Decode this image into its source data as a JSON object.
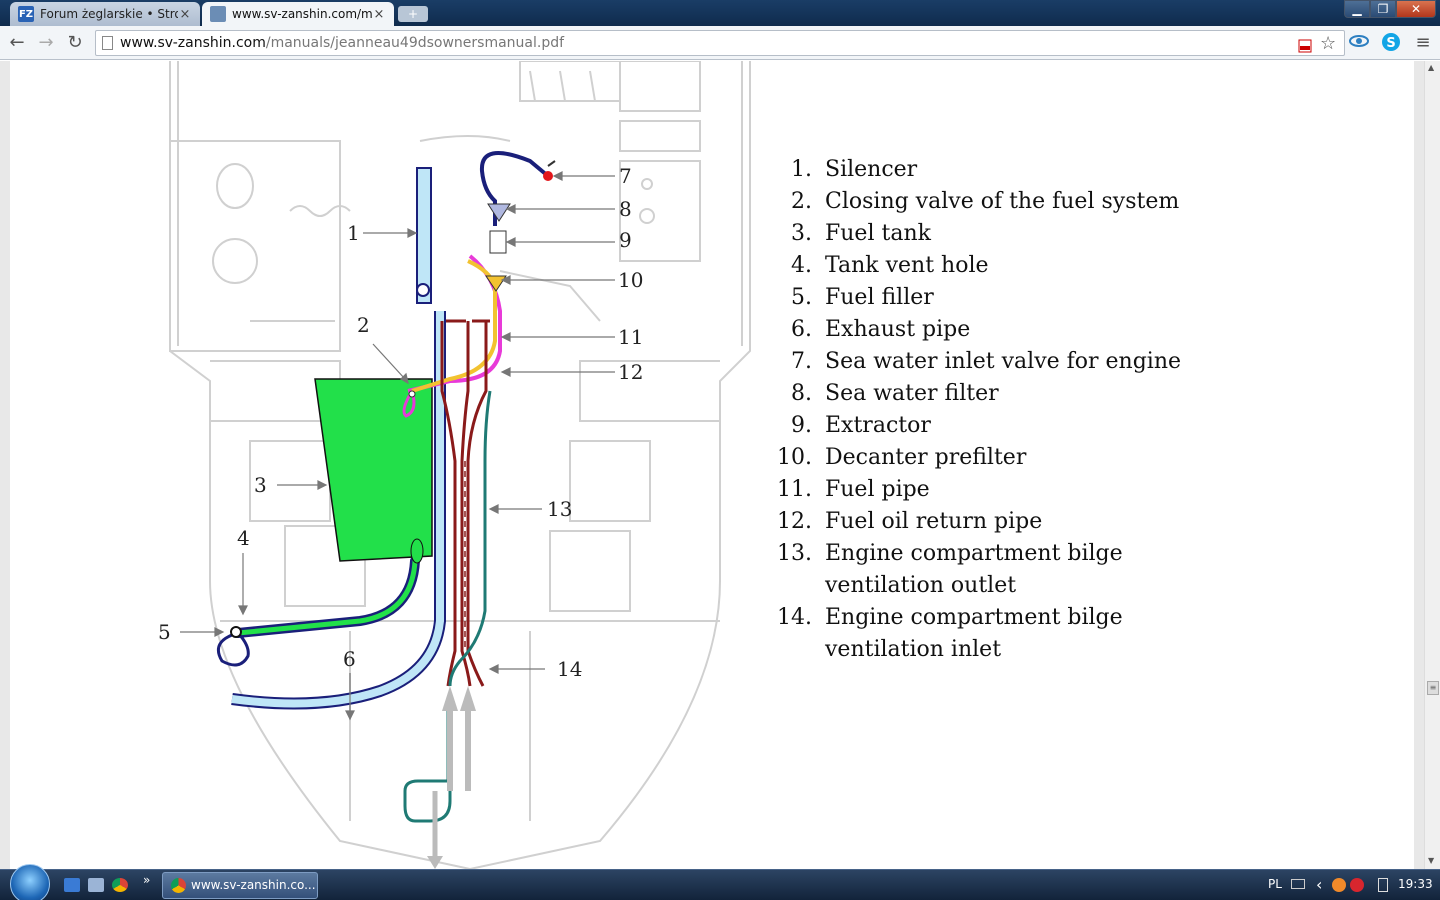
{
  "browser": {
    "tabs": [
      {
        "label": "Forum żeglarskie • Strona",
        "icon": "fz-favicon",
        "favicon_text": "FZ"
      },
      {
        "label": "www.sv-zanshin.com/ma",
        "icon": "page-favicon",
        "favicon_text": ""
      }
    ],
    "tab_close": "×",
    "new_tab": "+",
    "window_controls": {
      "minimize": "▁",
      "maximize": "❐",
      "close": "✕"
    },
    "nav": {
      "back": "←",
      "forward": "→",
      "reload": "↻"
    },
    "url_host": "www.sv-zanshin.com",
    "url_path": "/manuals/jeanneau49dsownersmanual.pdf"
  },
  "diagram": {
    "callouts": [
      {
        "num": "1"
      },
      {
        "num": "2"
      },
      {
        "num": "3"
      },
      {
        "num": "4"
      },
      {
        "num": "5"
      },
      {
        "num": "6"
      },
      {
        "num": "7"
      },
      {
        "num": "8"
      },
      {
        "num": "9"
      },
      {
        "num": "10"
      },
      {
        "num": "11"
      },
      {
        "num": "12"
      },
      {
        "num": "13"
      },
      {
        "num": "14"
      }
    ],
    "colors": {
      "fuel_tank": "#22e04a",
      "exhaust": "#bfe6f7",
      "sea_water": "#1a1f7a",
      "fuel_pipe": "#f2c230",
      "return_pipe": "#e83ad8",
      "bilge_outlet": "#8a1a1a",
      "bilge_inlet": "#1f7a74"
    }
  },
  "legend": [
    {
      "num": "1.",
      "text": "Silencer"
    },
    {
      "num": "2.",
      "text": "Closing valve of the fuel system"
    },
    {
      "num": "3.",
      "text": "Fuel tank"
    },
    {
      "num": "4.",
      "text": "Tank vent hole"
    },
    {
      "num": "5.",
      "text": "Fuel filler"
    },
    {
      "num": "6.",
      "text": "Exhaust pipe"
    },
    {
      "num": "7.",
      "text": "Sea water inlet valve for engine"
    },
    {
      "num": "8.",
      "text": "Sea water filter"
    },
    {
      "num": "9.",
      "text": "Extractor"
    },
    {
      "num": "10.",
      "text": "Decanter prefilter"
    },
    {
      "num": "11.",
      "text": "Fuel pipe"
    },
    {
      "num": "12.",
      "text": "Fuel oil return pipe"
    },
    {
      "num": "13.",
      "text": "Engine compartment bilge ventilation outlet"
    },
    {
      "num": "14.",
      "text": "Engine compartment bilge ventilation inlet"
    }
  ],
  "taskbar": {
    "task_label": "www.sv-zanshin.co...",
    "more": "»",
    "lang": "PL",
    "tray_arrow": "‹",
    "clock": "19:33"
  }
}
